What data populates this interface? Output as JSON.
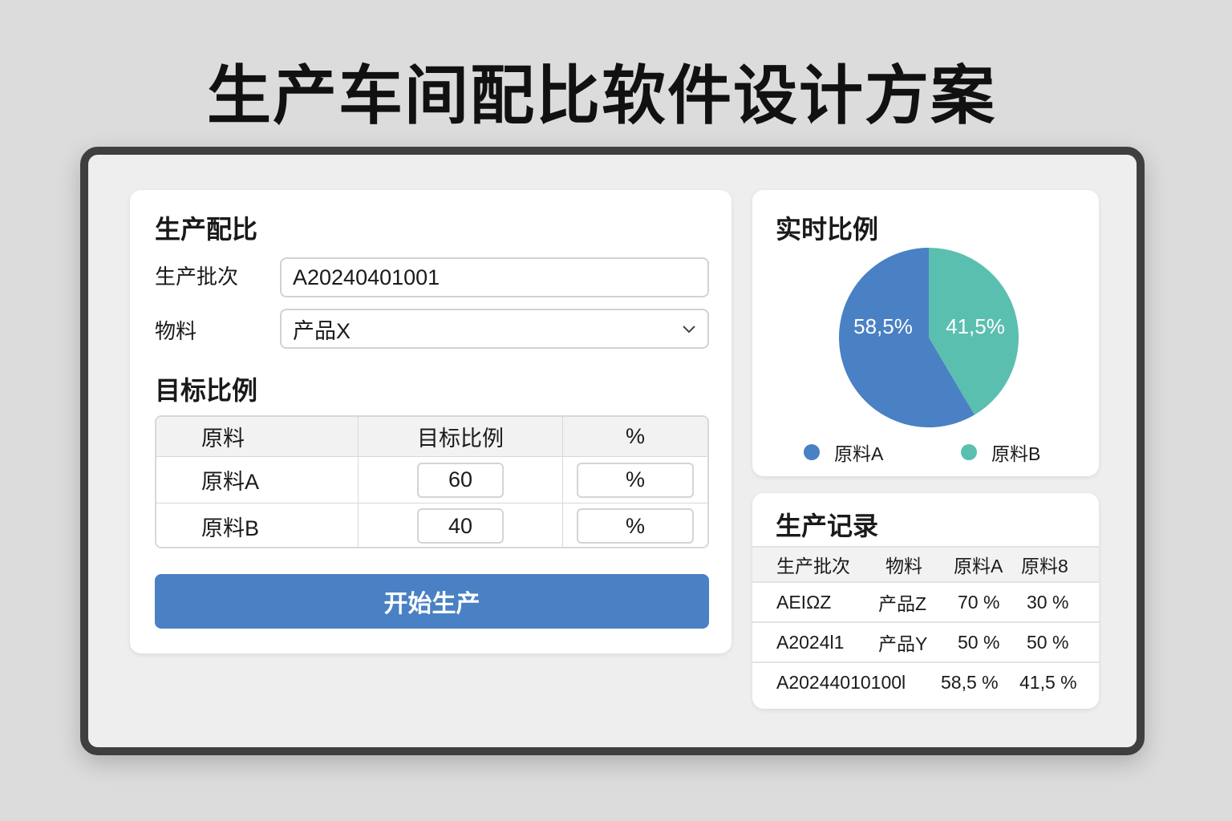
{
  "title": "生产车间配比软件设计方案",
  "form": {
    "heading": "生产配比",
    "batch_label": "生产批次",
    "batch_value": "A20240401001",
    "material_label": "物料",
    "material_value": "产品X"
  },
  "target": {
    "heading": "目标比例",
    "columns": [
      "原料",
      "目标比例",
      "%"
    ],
    "rows": [
      {
        "name": "原料A",
        "value": "60",
        "unit": "%"
      },
      {
        "name": "原料B",
        "value": "40",
        "unit": "%"
      }
    ]
  },
  "start_button": "开始生产",
  "realtime": {
    "heading": "实时比例",
    "slices": [
      {
        "name": "原料A",
        "value": 58.5,
        "label": "58,5%",
        "color": "#4a80c4"
      },
      {
        "name": "原料B",
        "value": 41.5,
        "label": "41,5%",
        "color": "#5bbfb0"
      }
    ]
  },
  "records": {
    "heading": "生产记录",
    "columns": [
      "生产批次",
      "物料",
      "原料A",
      "原料8"
    ],
    "rows": [
      [
        "AEIΩZ",
        "产品Z",
        "70 %",
        "30 %"
      ],
      [
        "A2024l1",
        "产品Y",
        "50 %",
        "50 %"
      ],
      [
        "A20244010100l",
        "58,5 %",
        "41,5 %"
      ]
    ]
  }
}
